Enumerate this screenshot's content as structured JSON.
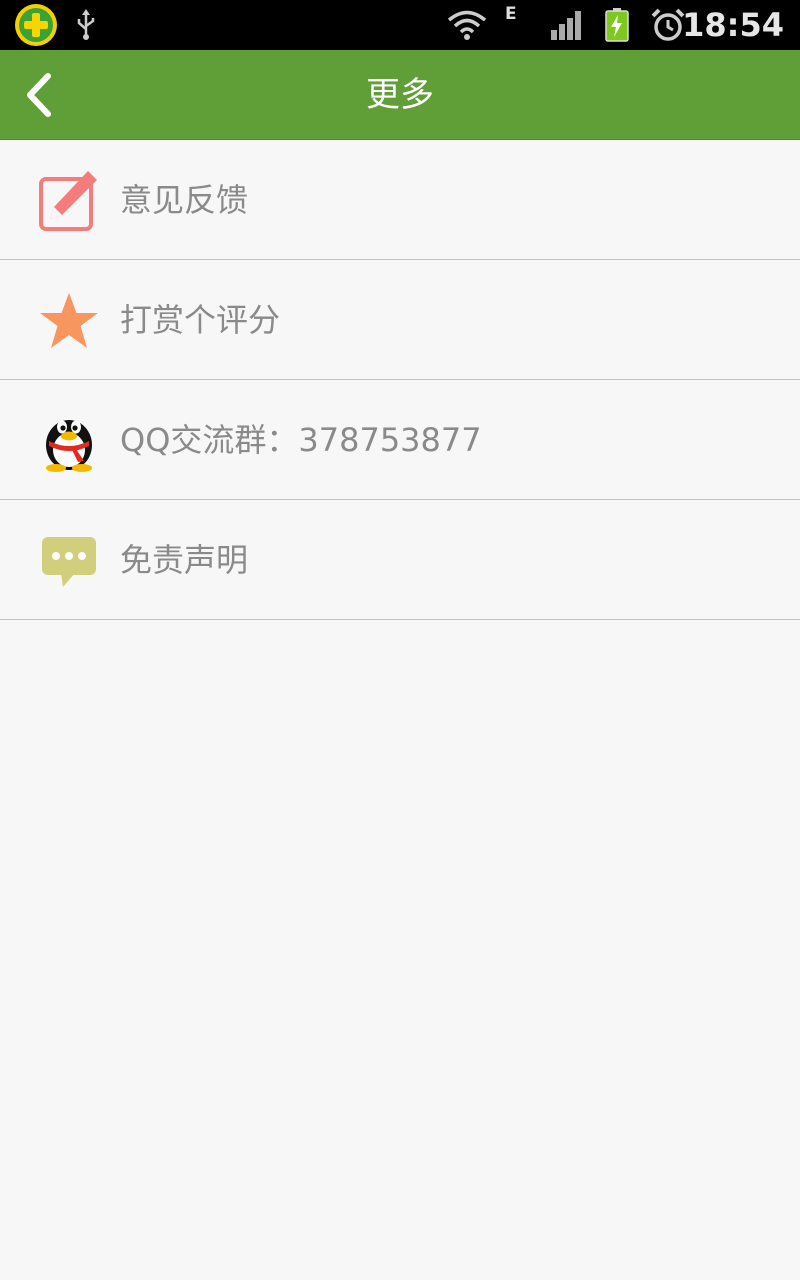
{
  "status_bar": {
    "time": "18:54",
    "network_type": "E",
    "icons": [
      "app-360-icon",
      "usb-icon",
      "wifi-icon",
      "signal-icon",
      "battery-charging-icon",
      "alarm-icon"
    ]
  },
  "header": {
    "title": "更多",
    "back_icon": "chevron-left-icon",
    "background_color": "#609e38"
  },
  "menu": {
    "items": [
      {
        "label": "意见反馈",
        "icon": "edit-pencil-icon",
        "icon_color": "#f47c7c"
      },
      {
        "label": "打赏个评分",
        "icon": "star-icon",
        "icon_color": "#f9955f"
      },
      {
        "label": "QQ交流群：378753877",
        "icon": "qq-penguin-icon",
        "icon_color": "#000000"
      },
      {
        "label": "免责声明",
        "icon": "chat-bubble-icon",
        "icon_color": "#d1cf7b"
      }
    ]
  }
}
